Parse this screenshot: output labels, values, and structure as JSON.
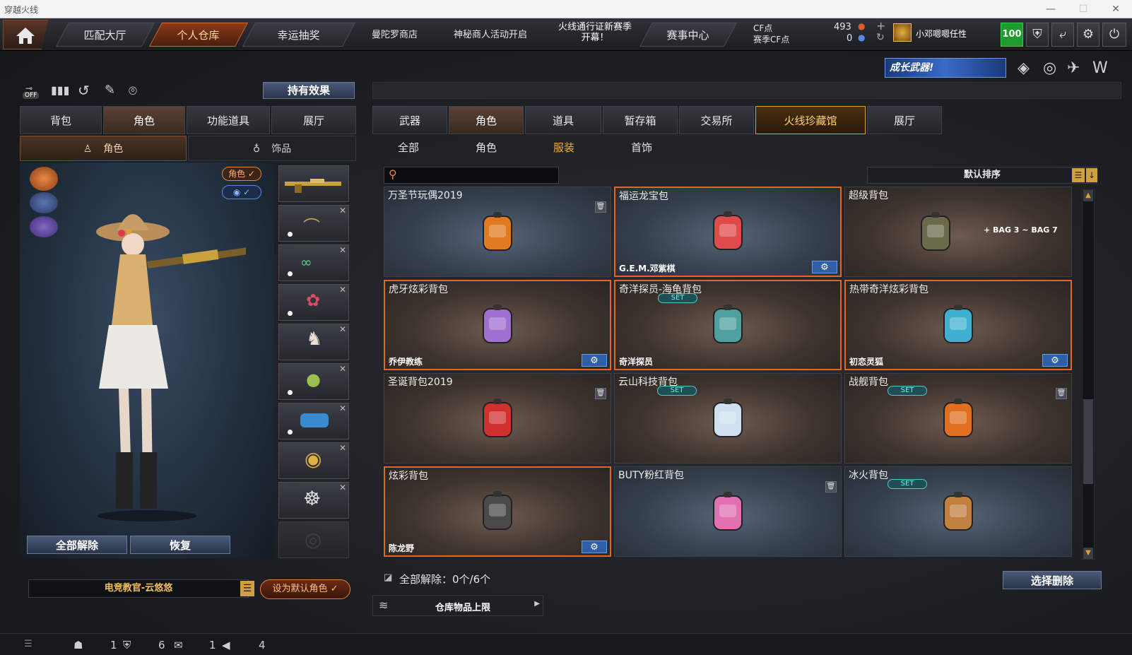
{
  "window": {
    "title": "穿越火线"
  },
  "topnav": {
    "tabs": [
      {
        "label": "匹配大厅",
        "active": false
      },
      {
        "label": "个人仓库",
        "active": true
      },
      {
        "label": "幸运抽奖",
        "active": false
      }
    ],
    "links": [
      "曼陀罗商店",
      "神秘商人活动开启"
    ],
    "season_line1": "火线通行证新赛季",
    "season_line2": "开幕！",
    "event_center": "赛事中心",
    "cf_label": "CF点",
    "season_cf_label": "赛季CF点",
    "cf_value": "493",
    "season_cf_value": "0",
    "username": "小邓嗯嗯任性",
    "level": "100"
  },
  "subbar": {
    "held_effect": "持有效果",
    "off_label": "OFF",
    "promo": "成长武器!"
  },
  "left": {
    "tabs": [
      {
        "label": "背包",
        "active": false
      },
      {
        "label": "角色",
        "active": true
      },
      {
        "label": "功能道具",
        "active": false
      },
      {
        "label": "展厅",
        "active": false
      }
    ],
    "subtabs": [
      {
        "label": "角色",
        "active": true
      },
      {
        "label": "饰品",
        "active": false
      }
    ],
    "role_badge": "角色 ✓",
    "view_badge": "◉ ✓",
    "unequip_all": "全部解除",
    "restore": "恢复",
    "character_name": "电竞教官-云悠悠",
    "set_default": "设为默认角色 ✓"
  },
  "right": {
    "tabs": [
      {
        "label": "武器",
        "active": false
      },
      {
        "label": "角色",
        "active": true
      },
      {
        "label": "道具",
        "active": false
      },
      {
        "label": "暂存箱",
        "active": false
      },
      {
        "label": "交易所",
        "active": false
      },
      {
        "label": "火线珍藏馆",
        "active": false
      },
      {
        "label": "展厅",
        "active": false
      }
    ],
    "subtabs": [
      {
        "label": "全部",
        "active": false
      },
      {
        "label": "角色",
        "active": false
      },
      {
        "label": "服装",
        "active": true
      },
      {
        "label": "首饰",
        "active": false
      }
    ],
    "search_placeholder": "",
    "sort": "默认排序",
    "items": [
      {
        "name": "万圣节玩偶2019",
        "owner": "",
        "style": "blue",
        "selected": false,
        "trash": true,
        "gear": false,
        "set": false,
        "icon": "pumpkin-doll"
      },
      {
        "name": "福运龙宝包",
        "owner": "G.E.M.邓紫棋",
        "style": "blue",
        "selected": true,
        "trash": false,
        "gear": true,
        "set": false,
        "icon": "dragon-bag"
      },
      {
        "name": "超级背包",
        "owner": "",
        "style": "brown",
        "selected": false,
        "trash": false,
        "gear": false,
        "set": false,
        "icon": "super-backpack",
        "extra": "+ BAG 3 ~ BAG 7"
      },
      {
        "name": "虎牙炫彩背包",
        "owner": "乔伊教练",
        "style": "brown",
        "selected": true,
        "trash": false,
        "gear": true,
        "set": false,
        "icon": "huya-backpack"
      },
      {
        "name": "奇洋探员-海龟背包",
        "owner": "奇洋探员",
        "style": "brown",
        "selected": true,
        "trash": false,
        "gear": false,
        "set": true,
        "icon": "turtle-backpack"
      },
      {
        "name": "热带奇洋炫彩背包",
        "owner": "初恋灵狐",
        "style": "brown",
        "selected": true,
        "trash": false,
        "gear": true,
        "set": false,
        "icon": "tropical-backpack"
      },
      {
        "name": "圣诞背包2019",
        "owner": "",
        "style": "brown",
        "selected": false,
        "trash": true,
        "gear": false,
        "set": false,
        "icon": "christmas-backpack"
      },
      {
        "name": "云山科技背包",
        "owner": "",
        "style": "brown",
        "selected": false,
        "trash": false,
        "gear": false,
        "set": true,
        "icon": "tech-backpack"
      },
      {
        "name": "战舰背包",
        "owner": "",
        "style": "brown",
        "selected": false,
        "trash": true,
        "gear": false,
        "set": true,
        "icon": "warship-backpack"
      },
      {
        "name": "炫彩背包",
        "owner": "陈龙野",
        "style": "brown",
        "selected": true,
        "trash": false,
        "gear": true,
        "set": false,
        "icon": "color-backpack"
      },
      {
        "name": "BUTY粉红背包",
        "owner": "",
        "style": "blue",
        "selected": false,
        "trash": true,
        "gear": false,
        "set": false,
        "icon": "pink-backpack"
      },
      {
        "name": "冰火背包",
        "owner": "",
        "style": "blue",
        "selected": false,
        "trash": false,
        "gear": false,
        "set": true,
        "icon": "icefire-backpack"
      }
    ],
    "set_label": "SET",
    "unequip_summary": "全部解除：0个/6个",
    "select_delete": "选择删除",
    "storage_limit": "仓库物品上限"
  },
  "statusbar": {
    "v1": "1",
    "v2": "6",
    "v3": "1",
    "v4": "4"
  }
}
